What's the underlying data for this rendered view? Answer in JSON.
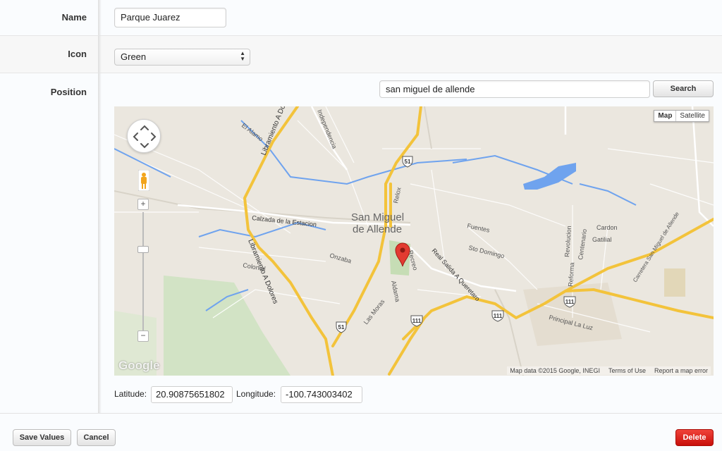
{
  "fields": {
    "name": {
      "label": "Name",
      "value": "Parque Juarez"
    },
    "icon": {
      "label": "Icon",
      "value": "Green",
      "icon_name": "select-arrows-icon"
    },
    "position": {
      "label": "Position",
      "search_value": "san miguel de allende",
      "search_button": "Search"
    }
  },
  "map": {
    "map_type_options": [
      "Map",
      "Satellite"
    ],
    "selected_map_type": "Map",
    "zoom_in": "+",
    "zoom_out": "−",
    "logo": "Google",
    "attribution": [
      "Map data ©2015 Google, INEGI",
      "Terms of Use",
      "Report a map error"
    ],
    "center_label": [
      "San Miguel",
      "de Allende"
    ],
    "street_labels": [
      "Libramiento A Dolores",
      "Libramiento A Dolores",
      "Independencia",
      "El Alamo",
      "Calzada de la Estacion",
      "Relox",
      "Recreo",
      "Fuentes",
      "Sto Domingo",
      "Onzaba",
      "Colonial",
      "Aldama",
      "Las Moras",
      "Real Salida A Queretaro",
      "Revolucion",
      "Centenario",
      "Reforma",
      "Cardon",
      "Gatilial",
      "Principal La Luz",
      "Carretera San Miguel de Allende"
    ],
    "route_shields": [
      "51",
      "51",
      "111",
      "111",
      "111"
    ],
    "colors": {
      "water": "#6fa3ee",
      "highway": "#f7d34e",
      "park": "#cfe2c2",
      "land": "#ebe7df",
      "marker": "#e23b31"
    }
  },
  "coords": {
    "latitude_label": "Latitude:",
    "latitude_value": "20.90875651802",
    "longitude_label": "Longitude:",
    "longitude_value": "-100.743003402"
  },
  "footer": {
    "save_label": "Save Values",
    "cancel_label": "Cancel",
    "delete_label": "Delete",
    "delete_color": "#d9140e"
  }
}
